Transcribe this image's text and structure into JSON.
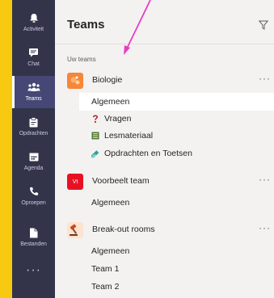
{
  "rail": {
    "items": [
      {
        "label": "Activiteit",
        "icon": "bell-icon"
      },
      {
        "label": "Chat",
        "icon": "chat-icon"
      },
      {
        "label": "Teams",
        "icon": "teams-icon"
      },
      {
        "label": "Opdrachten",
        "icon": "assignments-icon"
      },
      {
        "label": "Agenda",
        "icon": "calendar-icon"
      },
      {
        "label": "Oproepen",
        "icon": "phone-icon"
      },
      {
        "label": "Bestanden",
        "icon": "files-icon"
      }
    ],
    "more": "···"
  },
  "header": {
    "title": "Teams"
  },
  "section_label": "Uw teams",
  "teams": [
    {
      "name": "Biologie",
      "more": "···",
      "color": "#f7863a",
      "channels": [
        {
          "label": "Algemeen"
        },
        {
          "label": "Vragen"
        },
        {
          "label": "Lesmateriaal"
        },
        {
          "label": "Opdrachten en Toetsen"
        }
      ]
    },
    {
      "name": "Voorbeelt team",
      "more": "···",
      "color": "#e81123",
      "icon_text": "Vt",
      "channels": [
        {
          "label": "Algemeen"
        }
      ]
    },
    {
      "name": "Break-out rooms",
      "more": "···",
      "color": "#fce4d0",
      "channels": [
        {
          "label": "Algemeen"
        },
        {
          "label": "Team 1"
        },
        {
          "label": "Team 2"
        }
      ]
    }
  ],
  "colors": {
    "accent": "#464775",
    "rail": "#33344a",
    "frame": "#f7c910",
    "pointer": "#e83cc4"
  }
}
